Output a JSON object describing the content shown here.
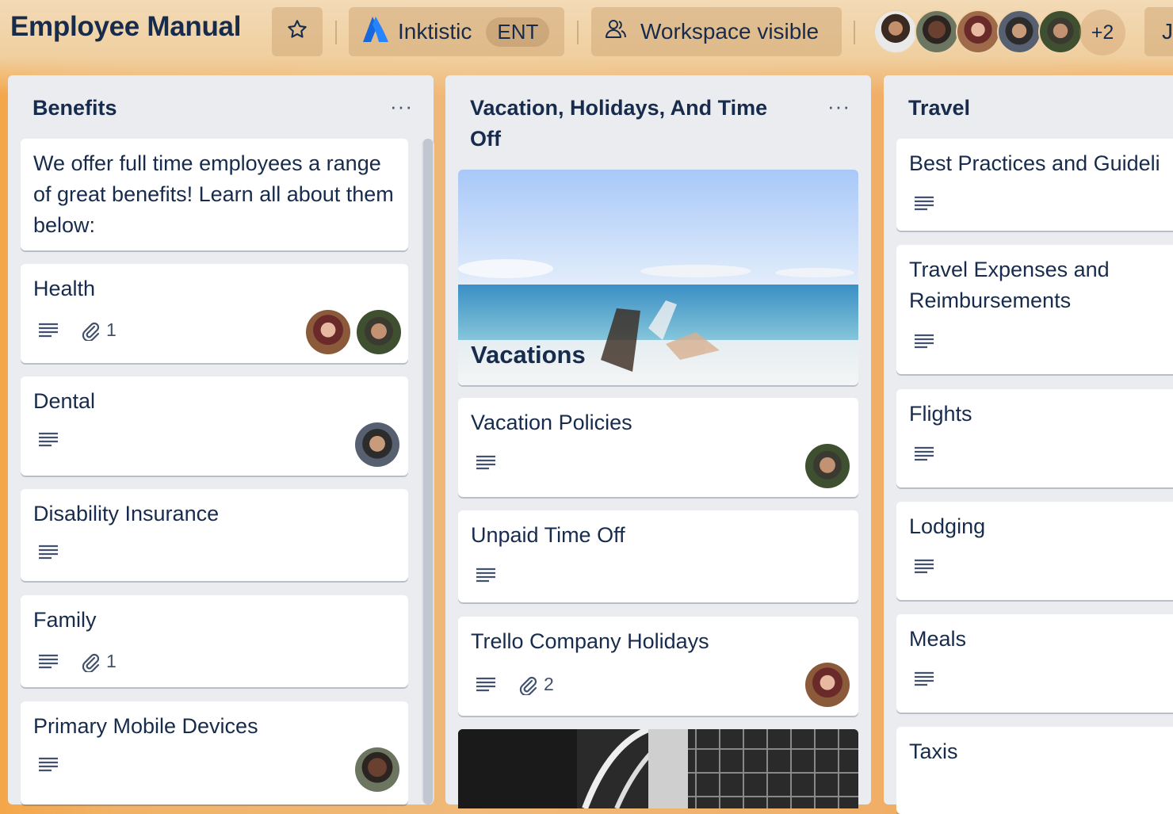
{
  "header": {
    "board_title": "Employee Manual",
    "workspace_name": "Inktistic",
    "workspace_badge": "ENT",
    "visibility_label": "Workspace visible",
    "extra_members": "+2",
    "cut_button_text": "J"
  },
  "lists": [
    {
      "title": "Benefits",
      "menu": "···",
      "cards": [
        {
          "title": "We offer full time employees a range of great benefits! Learn all about them below:"
        },
        {
          "title": "Health",
          "attachments": "1"
        },
        {
          "title": "Dental"
        },
        {
          "title": "Disability Insurance"
        },
        {
          "title": "Family",
          "attachments": "1"
        },
        {
          "title": "Primary Mobile Devices"
        }
      ]
    },
    {
      "title": "Vacation, Holidays, And Time Off",
      "menu": "···",
      "cards": [
        {
          "title": "Vacations"
        },
        {
          "title": "Vacation Policies"
        },
        {
          "title": "Unpaid Time Off"
        },
        {
          "title": "Trello Company Holidays",
          "attachments": "2"
        }
      ]
    },
    {
      "title": "Travel",
      "cards": [
        {
          "title": "Best Practices and Guideli"
        },
        {
          "title": "Travel Expenses and Reimbursements"
        },
        {
          "title": "Flights"
        },
        {
          "title": "Lodging"
        },
        {
          "title": "Meals"
        },
        {
          "title": "Taxis"
        }
      ]
    }
  ],
  "icons": {
    "star": "star-icon",
    "workspace": "atlassian-logo-icon",
    "visibility": "people-icon",
    "description": "description-icon",
    "attachment": "paperclip-icon"
  },
  "colors": {
    "text": "#172b4d",
    "list_bg": "#ebecf0",
    "card_bg": "#ffffff",
    "atlassian_blue": "#2684ff"
  }
}
